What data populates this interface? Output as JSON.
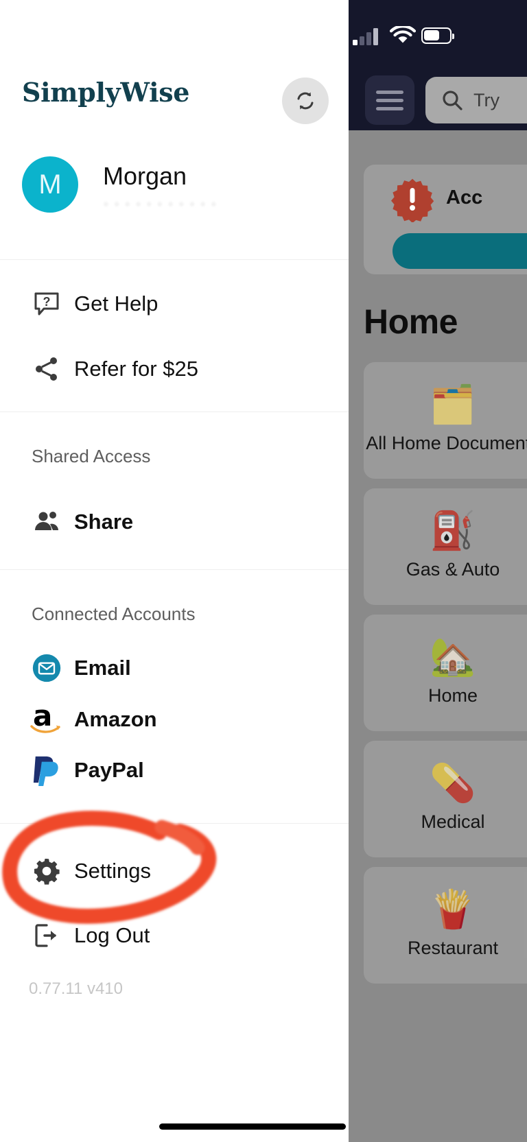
{
  "drawer": {
    "brand": "SimplyWise",
    "sync_icon": "sync-refresh-icon",
    "profile": {
      "avatar_initial": "M",
      "name": "Morgan",
      "subtitle_redacted": "• • • • • • • • • • •"
    },
    "support_items": [
      {
        "label": "Get Help",
        "icon": "help-chat-icon",
        "bold": false
      },
      {
        "label": "Refer for $25",
        "icon": "share-nodes-icon",
        "bold": false
      }
    ],
    "shared_access": {
      "section_label": "Shared Access",
      "items": [
        {
          "label": "Share",
          "icon": "people-icon",
          "bold": true
        }
      ]
    },
    "connected_accounts": {
      "section_label": "Connected Accounts",
      "items": [
        {
          "label": "Email",
          "icon": "email-envelope-icon",
          "bold": true
        },
        {
          "label": "Amazon",
          "icon": "amazon-logo-icon",
          "bold": true
        },
        {
          "label": "PayPal",
          "icon": "paypal-logo-icon",
          "bold": true
        }
      ]
    },
    "footer_items": [
      {
        "label": "Settings",
        "icon": "gear-icon",
        "bold": false
      },
      {
        "label": "Log Out",
        "icon": "logout-icon",
        "bold": false
      }
    ],
    "version": "0.77.11 v410"
  },
  "annotation": {
    "type": "hand-drawn-circle",
    "target": "Settings",
    "color": "#ef4a2a"
  },
  "app": {
    "status_bar": {
      "signal_icon": "cellular-signal-icon",
      "wifi_icon": "wifi-icon",
      "battery_icon": "battery-icon"
    },
    "header": {
      "menu_icon": "hamburger-menu-icon",
      "search_icon": "search-icon",
      "search_placeholder": "Try"
    },
    "alert_card": {
      "badge_icon": "alert-exclamation-badge-icon",
      "title": "Acc",
      "cta_label": ""
    },
    "page_title": "Home",
    "categories": [
      {
        "label": "All Home Documents",
        "emoji": "🗂️"
      },
      {
        "label": "Gas & Auto",
        "emoji": "⛽"
      },
      {
        "label": "Home",
        "emoji": "🏡"
      },
      {
        "label": "Medical",
        "emoji": "💊"
      },
      {
        "label": "Restaurant",
        "emoji": "🍟"
      }
    ]
  },
  "colors": {
    "brand_teal": "#12404e",
    "avatar_teal": "#0bb3cc",
    "annotation_red": "#ef4a2a",
    "statusbar_navy": "#15172b",
    "cta_teal": "#0a6e7c"
  }
}
